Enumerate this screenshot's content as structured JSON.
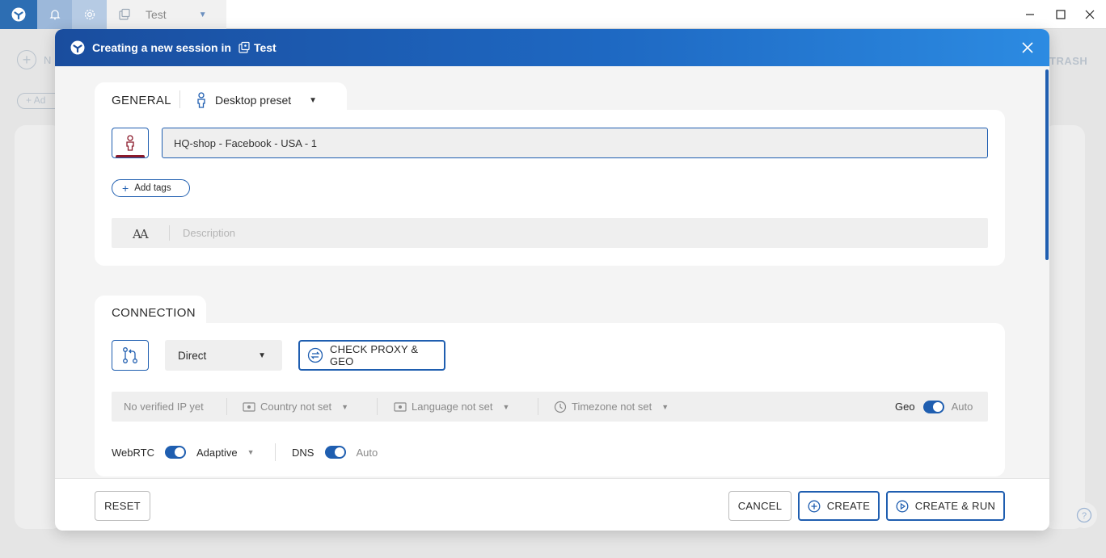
{
  "titlebar": {
    "workspace_name": "Test",
    "icons": [
      "app-logo-icon",
      "bell-icon",
      "gear-icon",
      "workspace-icon",
      "chevron-down-icon",
      "minimize-icon",
      "maximize-icon",
      "close-icon"
    ]
  },
  "background": {
    "new_label": "N",
    "add_label": "Ad",
    "trash_label": "TRASH"
  },
  "modal": {
    "title": "Creating a new session in",
    "workspace": "Test",
    "general": {
      "section_title": "GENERAL",
      "preset_label": "Desktop preset",
      "session_name": "HQ-shop - Facebook - USA - 1",
      "add_tags_label": "Add tags",
      "description_icon_text": "AA",
      "description_placeholder": "Description"
    },
    "connection": {
      "section_title": "CONNECTION",
      "connection_type": "Direct",
      "check_proxy_label": "CHECK PROXY & GEO",
      "ip_status": "No verified IP yet",
      "country": "Country not set",
      "language": "Language not set",
      "timezone": "Timezone not set",
      "geo_label": "Geo",
      "geo_mode": "Auto",
      "webrtc_label": "WebRTC",
      "webrtc_mode": "Adaptive",
      "dns_label": "DNS",
      "dns_mode": "Auto"
    },
    "footer": {
      "reset_label": "RESET",
      "cancel_label": "CANCEL",
      "create_label": "CREATE",
      "create_run_label": "CREATE & RUN"
    }
  },
  "colors": {
    "accent": "#1f5eb0",
    "header_start": "#1a4d9e",
    "header_end": "#2c8be2",
    "avatar_bar": "#8b1a2b"
  }
}
